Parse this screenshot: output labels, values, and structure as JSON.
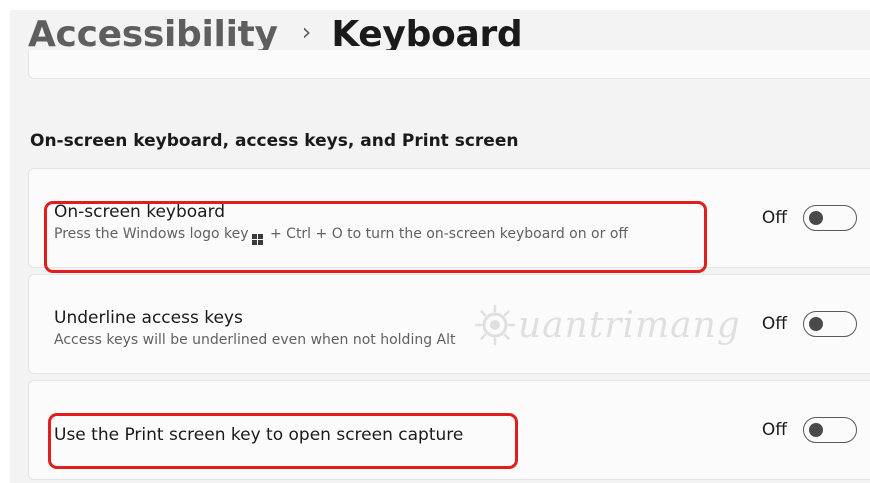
{
  "breadcrumb": {
    "parent": "Accessibility",
    "separator": "›",
    "current": "Keyboard"
  },
  "section": {
    "title": "On-screen keyboard, access keys, and Print screen"
  },
  "settings": [
    {
      "title": "On-screen keyboard",
      "description_before_logo": "Press the Windows logo key",
      "description_after_logo": " + Ctrl + O to turn the on-screen keyboard on or off",
      "state_label": "Off",
      "state": "off"
    },
    {
      "title": "Underline access keys",
      "description": "Access keys will be underlined even when not holding Alt",
      "state_label": "Off",
      "state": "off"
    },
    {
      "title": "Use the Print screen key to open screen capture",
      "state_label": "Off",
      "state": "off"
    }
  ],
  "watermark": {
    "text": "uantrimang",
    "icon": "sun-logo-icon"
  },
  "colors": {
    "background": "#f3f3f3",
    "card": "#fbfbfb",
    "highlight": "#e11d1d",
    "toggle_off": "#4a4a4a"
  }
}
